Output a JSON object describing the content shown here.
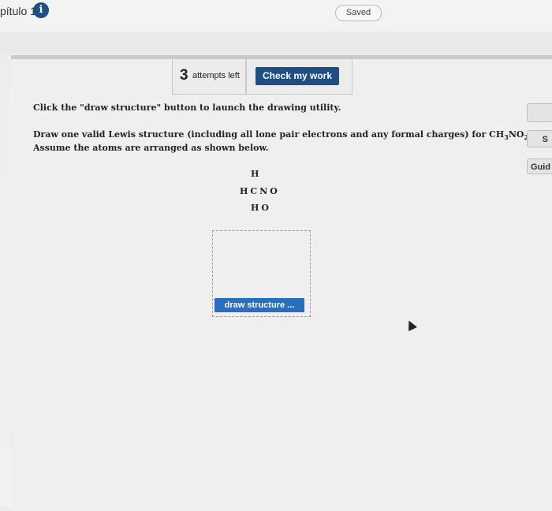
{
  "header": {
    "chapter_title": "pítulo 1",
    "info_icon": "i",
    "saved_label": "Saved"
  },
  "toolbar": {
    "attempts_count": "3",
    "attempts_label": "attempts left",
    "check_label": "Check my work"
  },
  "question": {
    "line1": "Click the \"draw structure\" button to launch the drawing utility.",
    "line2_prefix": "Draw one valid Lewis structure (including all lone pair electrons and any formal charges) for ",
    "formula": {
      "c": "CH",
      "s1": "3",
      "n": "NO",
      "s2": "2",
      "end": "."
    },
    "line3": "Assume the atoms are arranged as shown below."
  },
  "atoms": {
    "row1": "H",
    "row2": "HCNO",
    "row3": "HO"
  },
  "draw_button_label": "draw structure ...",
  "side": {
    "button2_label": "S",
    "guide_label": "Guid"
  },
  "colors": {
    "primary_button": "#1d4e84",
    "draw_button": "#2a6fbf"
  }
}
